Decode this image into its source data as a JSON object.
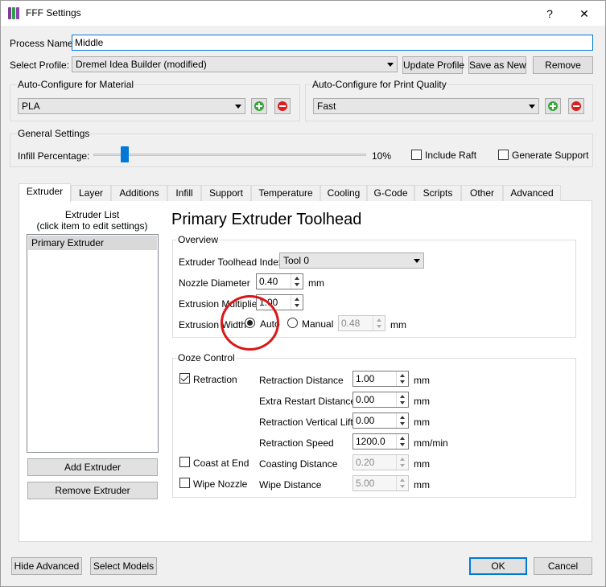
{
  "window": {
    "title": "FFF Settings",
    "help_glyph": "?",
    "close_glyph": "✕"
  },
  "process": {
    "label": "Process Name:",
    "value": "Middle"
  },
  "profile": {
    "label": "Select Profile:",
    "value": "Dremel Idea Builder (modified)",
    "update": "Update Profile",
    "save_as": "Save as New",
    "remove": "Remove"
  },
  "material": {
    "title": "Auto-Configure for Material",
    "value": "PLA"
  },
  "quality": {
    "title": "Auto-Configure for Print Quality",
    "value": "Fast"
  },
  "general": {
    "title": "General Settings",
    "infill_label": "Infill Percentage:",
    "infill_value": "10%",
    "infill_level": 0.1,
    "raft": "Include Raft",
    "support": "Generate Support"
  },
  "tabs": [
    "Extruder",
    "Layer",
    "Additions",
    "Infill",
    "Support",
    "Temperature",
    "Cooling",
    "G-Code",
    "Scripts",
    "Other",
    "Advanced"
  ],
  "extruder_list": {
    "title_line1": "Extruder List",
    "title_line2": "(click item to edit settings)",
    "items": [
      "Primary Extruder"
    ],
    "add": "Add Extruder",
    "remove": "Remove Extruder"
  },
  "toolhead": {
    "heading": "Primary Extruder Toolhead"
  },
  "overview": {
    "title": "Overview",
    "index_label": "Extruder Toolhead Index",
    "index_value": "Tool 0",
    "nozzle_label": "Nozzle Diameter",
    "nozzle_value": "0.40",
    "nozzle_unit": "mm",
    "mult_label": "Extrusion Multiplier",
    "mult_value": "1.00",
    "width_label": "Extrusion Width",
    "auto": "Auto",
    "manual": "Manual",
    "width_value": "0.48",
    "width_unit": "mm"
  },
  "ooze": {
    "title": "Ooze Control",
    "retraction": "Retraction",
    "coast": "Coast at End",
    "wipe": "Wipe Nozzle",
    "rows": [
      {
        "label": "Retraction Distance",
        "value": "1.00",
        "unit": "mm"
      },
      {
        "label": "Extra Restart Distance",
        "value": "0.00",
        "unit": "mm"
      },
      {
        "label": "Retraction Vertical Lift",
        "value": "0.00",
        "unit": "mm"
      },
      {
        "label": "Retraction Speed",
        "value": "1200.0",
        "unit": "mm/min"
      },
      {
        "label": "Coasting Distance",
        "value": "0.20",
        "unit": "mm"
      },
      {
        "label": "Wipe Distance",
        "value": "5.00",
        "unit": "mm"
      }
    ]
  },
  "footer": {
    "hide_advanced": "Hide Advanced",
    "select_models": "Select Models",
    "ok": "OK",
    "cancel": "Cancel"
  },
  "colors": {
    "accent": "#0078d7",
    "annotation": "#d81818",
    "add": "#3aa53a",
    "remove": "#d92020"
  }
}
